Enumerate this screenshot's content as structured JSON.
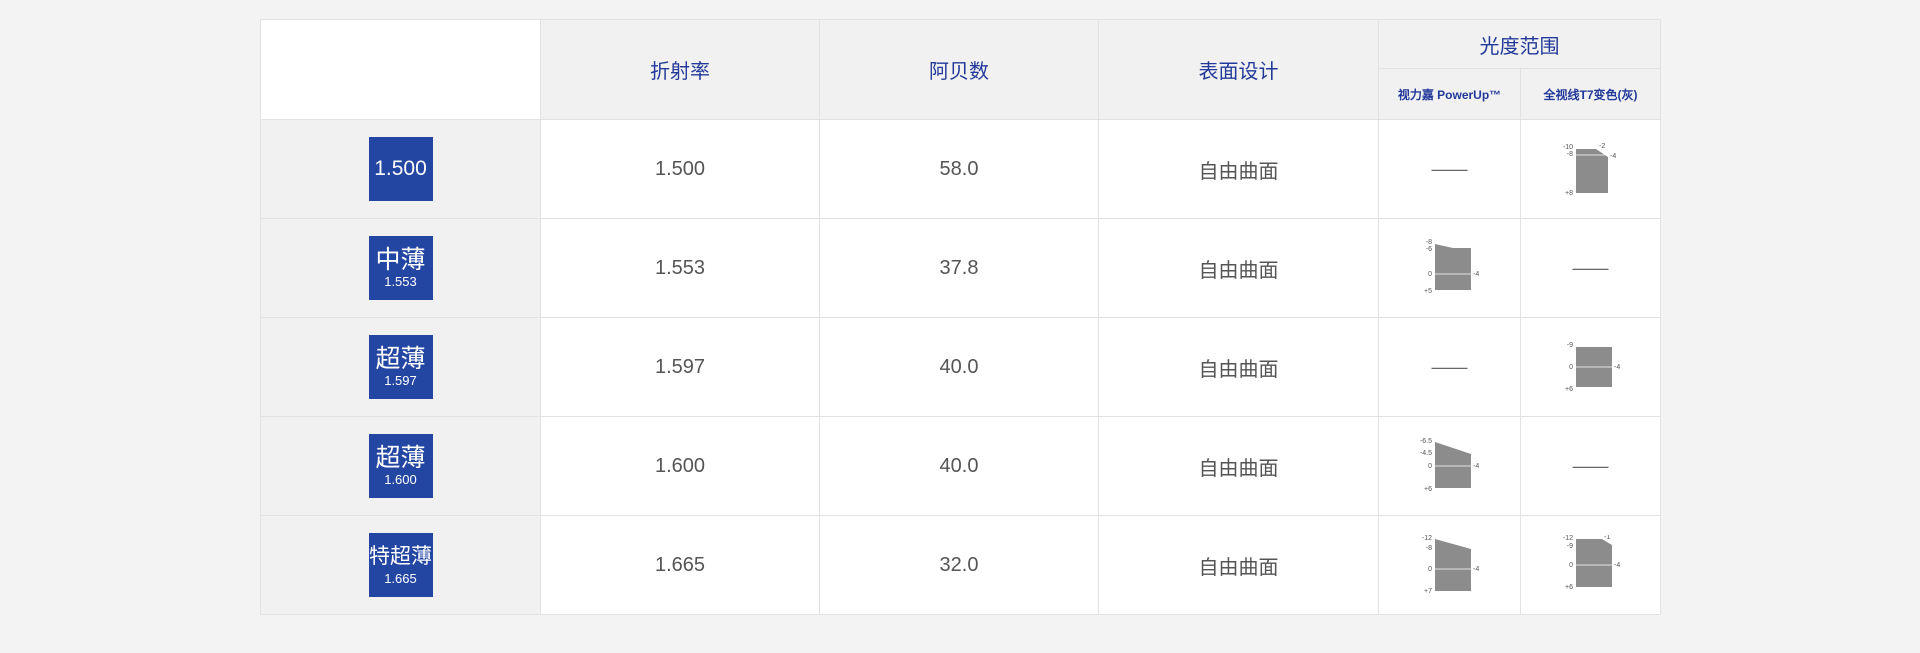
{
  "headers": {
    "refractive": "折射率",
    "abbe": "阿贝数",
    "surface": "表面设计",
    "power_range": "光度范围",
    "powerup": "视力嘉 PowerUp™",
    "t7": "全视线T7变色(灰)"
  },
  "rows": [
    {
      "badge_main": "1.500",
      "badge_sub": "",
      "refractive": "1.500",
      "abbe": "58.0",
      "surface": "自由曲面",
      "powerup": {
        "dash": "——"
      },
      "t7": {
        "labels_left": [
          "-10",
          "-8",
          "+8"
        ],
        "labels_right": [
          "-2",
          "-4"
        ]
      }
    },
    {
      "badge_main": "中薄",
      "badge_sub": "1.553",
      "refractive": "1.553",
      "abbe": "37.8",
      "surface": "自由曲面",
      "powerup": {
        "labels_left": [
          "-8",
          "-6",
          "0",
          "+5"
        ],
        "labels_right": [
          "-4"
        ]
      },
      "t7": {
        "dash": "——"
      }
    },
    {
      "badge_main": "超薄",
      "badge_sub": "1.597",
      "refractive": "1.597",
      "abbe": "40.0",
      "surface": "自由曲面",
      "powerup": {
        "dash": "——"
      },
      "t7": {
        "labels_left": [
          "-9",
          "0",
          "+6"
        ],
        "labels_right": [
          "-4"
        ]
      }
    },
    {
      "badge_main": "超薄",
      "badge_sub": "1.600",
      "refractive": "1.600",
      "abbe": "40.0",
      "surface": "自由曲面",
      "powerup": {
        "labels_left": [
          "-6.5",
          "-4.5",
          "0",
          "+6"
        ],
        "labels_right": [
          "-4"
        ]
      },
      "t7": {
        "dash": "——"
      }
    },
    {
      "badge_main": "特超薄",
      "badge_sub": "1.665",
      "refractive": "1.665",
      "abbe": "32.0",
      "surface": "自由曲面",
      "powerup": {
        "labels_left": [
          "-12",
          "-8",
          "0",
          "+7"
        ],
        "labels_right": [
          "-4"
        ]
      },
      "t7": {
        "labels_left": [
          "-12",
          "-9",
          "0",
          "+6"
        ],
        "labels_right": [
          "-1",
          "-4"
        ]
      }
    }
  ]
}
